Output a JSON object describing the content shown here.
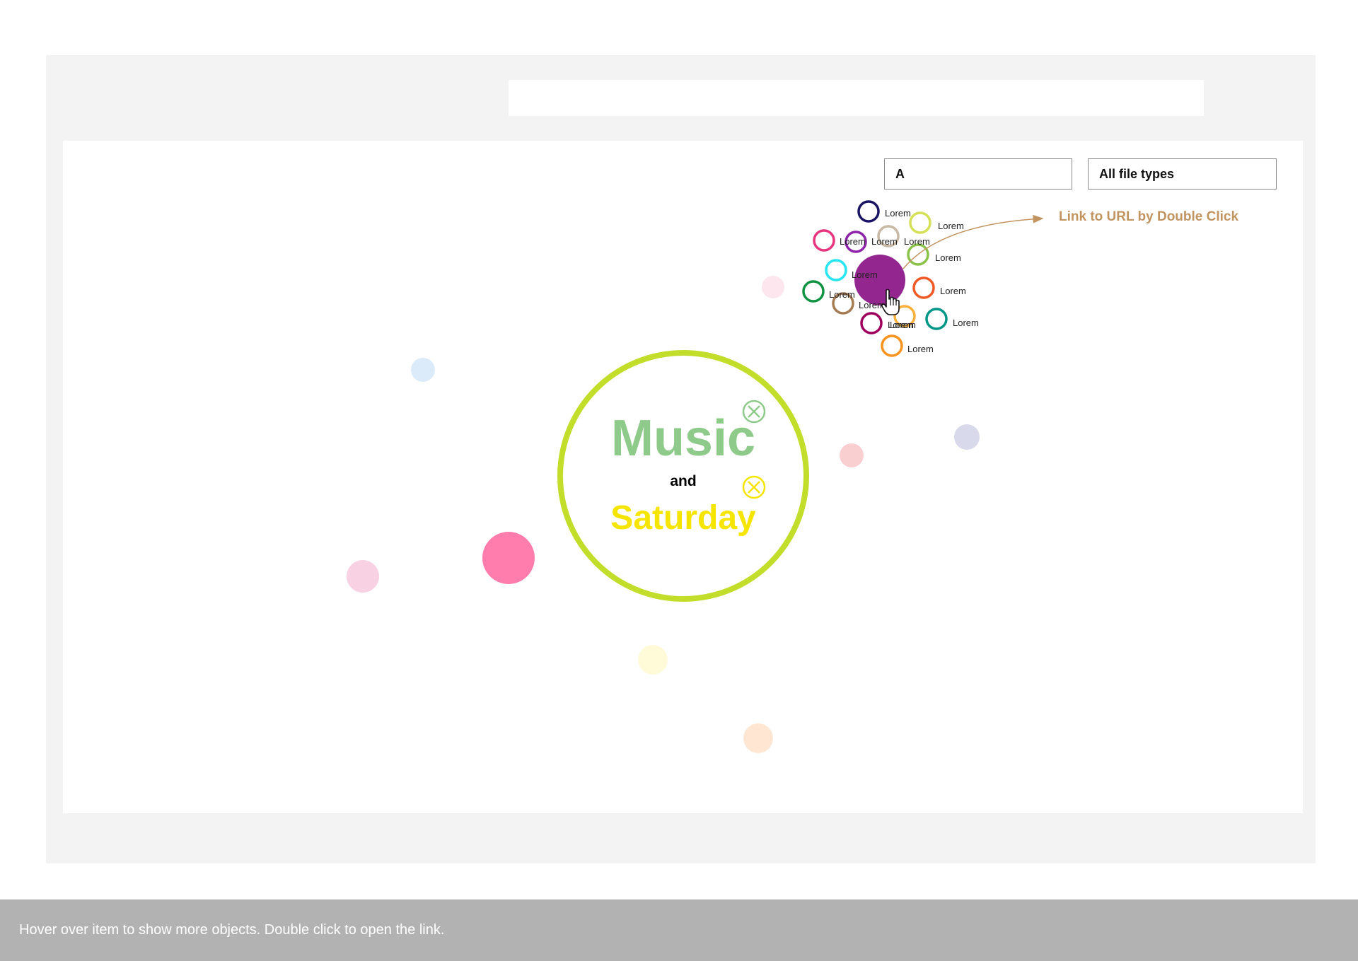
{
  "search": {
    "value": "A"
  },
  "file_type": {
    "selected": "All file types"
  },
  "hint": {
    "text": "Link to URL by Double Click",
    "color": "#c19460"
  },
  "center": {
    "word1": "Music",
    "word1_color": "#8ecb8a",
    "connector": "and",
    "word2": "Saturday",
    "word2_color": "#f5e500",
    "ring_color": "#c3dd2b"
  },
  "bubbles": [
    {
      "color": "#fde6ee"
    },
    {
      "color": "#dcebf9"
    },
    {
      "color": "#f9cfcf"
    },
    {
      "color": "#d9d9ec"
    },
    {
      "color": "#fe7dad"
    },
    {
      "color": "#f8d2e2"
    },
    {
      "color": "#fffbd8"
    },
    {
      "color": "#ffe6d2"
    }
  ],
  "hub": {
    "color": "#93278f"
  },
  "satellites": [
    {
      "label": "Lorem",
      "color": "#1b1464"
    },
    {
      "label": "Lorem",
      "color": "#d4e157"
    },
    {
      "label": "Lorem",
      "color": "#e7357f"
    },
    {
      "label": "Lorem",
      "color": "#8e24aa"
    },
    {
      "label": "Lorem",
      "color": "#c8b9a5"
    },
    {
      "label": "Lorem",
      "color": "#8bc34a"
    },
    {
      "label": "Lorem",
      "color": "#26e5f0"
    },
    {
      "label": "Lorem",
      "color": "#f15a24"
    },
    {
      "label": "Lorem",
      "color": "#109444"
    },
    {
      "label": "Lorem",
      "color": "#a67c52"
    },
    {
      "label": "Lorem",
      "color": "#fbb03b"
    },
    {
      "label": "Lorem",
      "color": "#009688"
    },
    {
      "label": "Lorem",
      "color": "#9e005d"
    },
    {
      "label": "Lorem",
      "color": "#f7931e"
    }
  ],
  "footer": {
    "caption": "Hover over item to show more objects. Double click to open the link."
  }
}
